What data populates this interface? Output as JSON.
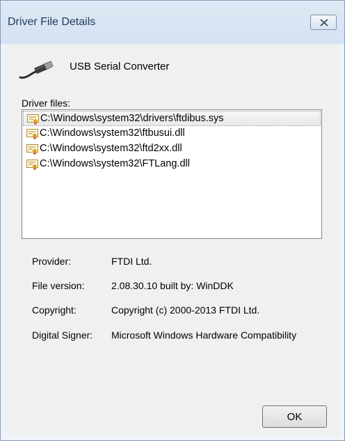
{
  "window": {
    "title": "Driver File Details"
  },
  "device": {
    "name": "USB Serial Converter",
    "icon": "usb-plug-icon"
  },
  "driver_files": {
    "label": "Driver files:",
    "selected_index": 0,
    "items": [
      "C:\\Windows\\system32\\drivers\\ftdibus.sys",
      "C:\\Windows\\system32\\ftbusui.dll",
      "C:\\Windows\\system32\\ftd2xx.dll",
      "C:\\Windows\\system32\\FTLang.dll"
    ]
  },
  "properties": {
    "provider": {
      "label": "Provider:",
      "value": "FTDI Ltd."
    },
    "file_version": {
      "label": "File version:",
      "value": "2.08.30.10 built by: WinDDK"
    },
    "copyright": {
      "label": "Copyright:",
      "value": "Copyright (c) 2000-2013 FTDI Ltd."
    },
    "digital_signer": {
      "label": "Digital Signer:",
      "value": "Microsoft Windows Hardware Compatibility"
    }
  },
  "buttons": {
    "ok": "OK"
  }
}
